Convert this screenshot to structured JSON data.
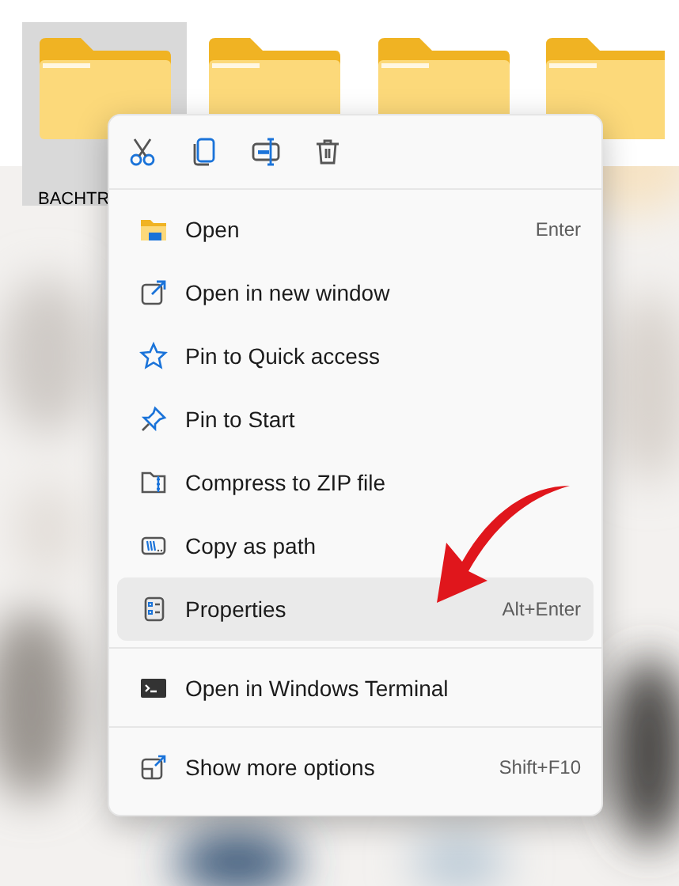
{
  "folders": [
    {
      "label": "BACHTR",
      "selected": true
    },
    {
      "selected": false
    },
    {
      "selected": false
    },
    {
      "selected": false
    }
  ],
  "context_menu": {
    "toolbar": [
      {
        "kind": "cut"
      },
      {
        "kind": "copy"
      },
      {
        "kind": "rename"
      },
      {
        "kind": "delete"
      }
    ],
    "groups": [
      [
        {
          "kind": "open",
          "label": "Open",
          "shortcut": "Enter",
          "selected": false
        },
        {
          "kind": "new-window",
          "label": "Open in new window",
          "selected": false
        },
        {
          "kind": "star",
          "label": "Pin to Quick access",
          "selected": false
        },
        {
          "kind": "pin",
          "label": "Pin to Start",
          "selected": false
        },
        {
          "kind": "zip",
          "label": "Compress to ZIP file",
          "selected": false
        },
        {
          "kind": "path",
          "label": "Copy as path",
          "selected": false
        },
        {
          "kind": "properties",
          "label": "Properties",
          "shortcut": "Alt+Enter",
          "selected": true
        }
      ],
      [
        {
          "kind": "terminal",
          "label": "Open in Windows Terminal",
          "selected": false
        }
      ],
      [
        {
          "kind": "more",
          "label": "Show more options",
          "shortcut": "Shift+F10",
          "selected": false
        }
      ]
    ]
  }
}
